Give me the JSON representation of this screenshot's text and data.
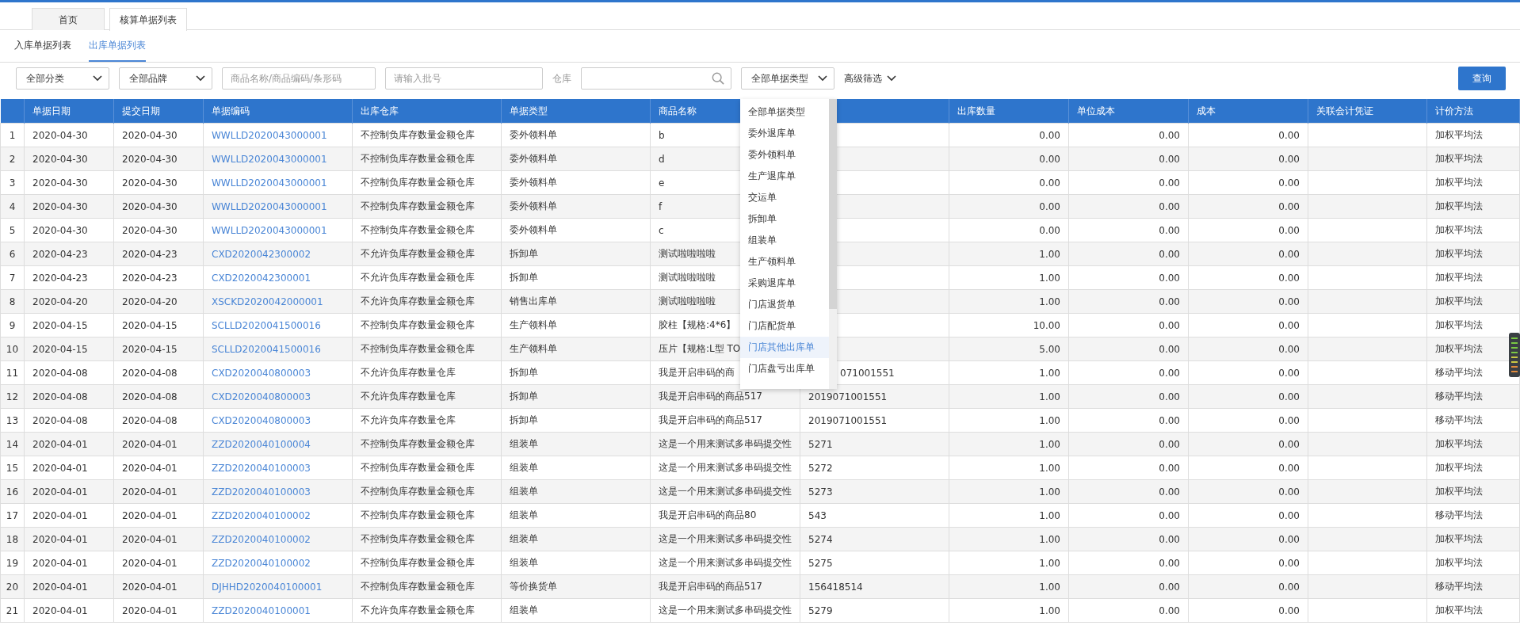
{
  "tabs": [
    {
      "label": "首页",
      "selected": false
    },
    {
      "label": "核算单据列表",
      "selected": true
    }
  ],
  "subtabs": [
    {
      "label": "入库单据列表",
      "selected": false
    },
    {
      "label": "出库单据列表",
      "selected": true
    }
  ],
  "filters": {
    "category": "全部分类",
    "brand": "全部品牌",
    "product_search": {
      "placeholder": "商品名称/商品编码/条形码"
    },
    "batch": {
      "placeholder": "请输入批号"
    },
    "warehouse_label": "仓库",
    "doc_type": "全部单据类型",
    "advanced": "高级筛选",
    "query_button": "查询"
  },
  "doc_type_menu": [
    {
      "label": "全部单据类型",
      "highlighted": false
    },
    {
      "label": "委外退库单",
      "highlighted": false
    },
    {
      "label": "委外领料单",
      "highlighted": false
    },
    {
      "label": "生产退库单",
      "highlighted": false
    },
    {
      "label": "交运单",
      "highlighted": false
    },
    {
      "label": "拆卸单",
      "highlighted": false
    },
    {
      "label": "组装单",
      "highlighted": false
    },
    {
      "label": "生产领料单",
      "highlighted": false
    },
    {
      "label": "采购退库单",
      "highlighted": false
    },
    {
      "label": "门店退货单",
      "highlighted": false
    },
    {
      "label": "门店配货单",
      "highlighted": false
    },
    {
      "label": "门店其他出库单",
      "highlighted": true
    },
    {
      "label": "门店盘亏出库单",
      "highlighted": false
    }
  ],
  "table": {
    "columns": [
      "单据日期",
      "提交日期",
      "单据编码",
      "出库仓库",
      "单据类型",
      "商品名称",
      "出库数量",
      "单位成本",
      "成本",
      "关联会计凭证",
      "计价方法"
    ],
    "rows": [
      {
        "no": "1",
        "date": "2020-04-30",
        "submitted": "2020-04-30",
        "code": "WWLLD2020043000001",
        "warehouse": "不控制负库存数量金额仓库",
        "type": "委外领料单",
        "product": "b",
        "qty": "0.00",
        "unit_cost": "0.00",
        "cost": "0.00",
        "method": "加权平均法"
      },
      {
        "no": "2",
        "date": "2020-04-30",
        "submitted": "2020-04-30",
        "code": "WWLLD2020043000001",
        "warehouse": "不控制负库存数量金额仓库",
        "type": "委外领料单",
        "product": "d",
        "qty": "0.00",
        "unit_cost": "0.00",
        "cost": "0.00",
        "method": "加权平均法"
      },
      {
        "no": "3",
        "date": "2020-04-30",
        "submitted": "2020-04-30",
        "code": "WWLLD2020043000001",
        "warehouse": "不控制负库存数量金额仓库",
        "type": "委外领料单",
        "product": "e",
        "qty": "0.00",
        "unit_cost": "0.00",
        "cost": "0.00",
        "method": "加权平均法"
      },
      {
        "no": "4",
        "date": "2020-04-30",
        "submitted": "2020-04-30",
        "code": "WWLLD2020043000001",
        "warehouse": "不控制负库存数量金额仓库",
        "type": "委外领料单",
        "product": "f",
        "qty": "0.00",
        "unit_cost": "0.00",
        "cost": "0.00",
        "method": "加权平均法"
      },
      {
        "no": "5",
        "date": "2020-04-30",
        "submitted": "2020-04-30",
        "code": "WWLLD2020043000001",
        "warehouse": "不控制负库存数量金额仓库",
        "type": "委外领料单",
        "product": "c",
        "qty": "0.00",
        "unit_cost": "0.00",
        "cost": "0.00",
        "method": "加权平均法"
      },
      {
        "no": "6",
        "date": "2020-04-23",
        "submitted": "2020-04-23",
        "code": "CXD2020042300002",
        "warehouse": "不允许负库存数量金额仓库",
        "type": "拆卸单",
        "product": "测试啦啦啦啦",
        "qty": "1.00",
        "unit_cost": "0.00",
        "cost": "0.00",
        "method": "加权平均法"
      },
      {
        "no": "7",
        "date": "2020-04-23",
        "submitted": "2020-04-23",
        "code": "CXD2020042300001",
        "warehouse": "不允许负库存数量金额仓库",
        "type": "拆卸单",
        "product": "测试啦啦啦啦",
        "qty": "1.00",
        "unit_cost": "0.00",
        "cost": "0.00",
        "method": "加权平均法"
      },
      {
        "no": "8",
        "date": "2020-04-20",
        "submitted": "2020-04-20",
        "code": "XSCKD2020042000001",
        "warehouse": "不允许负库存数量金额仓库",
        "type": "销售出库单",
        "product": "测试啦啦啦啦",
        "qty": "1.00",
        "unit_cost": "0.00",
        "cost": "0.00",
        "method": "加权平均法"
      },
      {
        "no": "9",
        "date": "2020-04-15",
        "submitted": "2020-04-15",
        "code": "SCLLD2020041500016",
        "warehouse": "不控制负库存数量金额仓库",
        "type": "生产领料单",
        "product": "胶柱【规格:4*6】",
        "qty": "10.00",
        "unit_cost": "0.00",
        "cost": "0.00",
        "method": "加权平均法"
      },
      {
        "no": "10",
        "date": "2020-04-15",
        "submitted": "2020-04-15",
        "code": "SCLLD2020041500016",
        "warehouse": "不控制负库存数量金额仓库",
        "type": "生产领料单",
        "product": "压片【规格:L型 TO",
        "qty": "5.00",
        "unit_cost": "0.00",
        "cost": "0.00",
        "method": "加权平均法"
      },
      {
        "no": "11",
        "date": "2020-04-08",
        "submitted": "2020-04-08",
        "code": "CXD2020040800003",
        "warehouse": "不允许负库存数量仓库",
        "type": "拆卸单",
        "product": "我是开启串码的商",
        "column_7": "071001551",
        "qty": "1.00",
        "unit_cost": "0.00",
        "cost": "0.00",
        "method": "移动平均法"
      },
      {
        "no": "12",
        "date": "2020-04-08",
        "submitted": "2020-04-08",
        "code": "CXD2020040800003",
        "warehouse": "不允许负库存数量仓库",
        "type": "拆卸单",
        "product": "我是开启串码的商品517",
        "column_7": "2019071001551",
        "qty": "1.00",
        "unit_cost": "0.00",
        "cost": "0.00",
        "method": "移动平均法"
      },
      {
        "no": "13",
        "date": "2020-04-08",
        "submitted": "2020-04-08",
        "code": "CXD2020040800003",
        "warehouse": "不允许负库存数量仓库",
        "type": "拆卸单",
        "product": "我是开启串码的商品517",
        "column_7": "2019071001551",
        "qty": "1.00",
        "unit_cost": "0.00",
        "cost": "0.00",
        "method": "移动平均法"
      },
      {
        "no": "14",
        "date": "2020-04-01",
        "submitted": "2020-04-01",
        "code": "ZZD2020040100004",
        "warehouse": "不控制负库存数量金额仓库",
        "type": "组装单",
        "product": "这是一个用来测试多串码提交性",
        "column_7": "5271",
        "qty": "1.00",
        "unit_cost": "0.00",
        "cost": "0.00",
        "method": "加权平均法"
      },
      {
        "no": "15",
        "date": "2020-04-01",
        "submitted": "2020-04-01",
        "code": "ZZD2020040100003",
        "warehouse": "不控制负库存数量金额仓库",
        "type": "组装单",
        "product": "这是一个用来测试多串码提交性",
        "column_7": "5272",
        "qty": "1.00",
        "unit_cost": "0.00",
        "cost": "0.00",
        "method": "加权平均法"
      },
      {
        "no": "16",
        "date": "2020-04-01",
        "submitted": "2020-04-01",
        "code": "ZZD2020040100003",
        "warehouse": "不控制负库存数量金额仓库",
        "type": "组装单",
        "product": "这是一个用来测试多串码提交性",
        "column_7": "5273",
        "qty": "1.00",
        "unit_cost": "0.00",
        "cost": "0.00",
        "method": "加权平均法"
      },
      {
        "no": "17",
        "date": "2020-04-01",
        "submitted": "2020-04-01",
        "code": "ZZD2020040100002",
        "warehouse": "不控制负库存数量金额仓库",
        "type": "组装单",
        "product": "我是开启串码的商品80",
        "column_7": "543",
        "qty": "1.00",
        "unit_cost": "0.00",
        "cost": "0.00",
        "method": "移动平均法"
      },
      {
        "no": "18",
        "date": "2020-04-01",
        "submitted": "2020-04-01",
        "code": "ZZD2020040100002",
        "warehouse": "不控制负库存数量金额仓库",
        "type": "组装单",
        "product": "这是一个用来测试多串码提交性",
        "column_7": "5274",
        "qty": "1.00",
        "unit_cost": "0.00",
        "cost": "0.00",
        "method": "加权平均法"
      },
      {
        "no": "19",
        "date": "2020-04-01",
        "submitted": "2020-04-01",
        "code": "ZZD2020040100002",
        "warehouse": "不控制负库存数量金额仓库",
        "type": "组装单",
        "product": "这是一个用来测试多串码提交性",
        "column_7": "5275",
        "qty": "1.00",
        "unit_cost": "0.00",
        "cost": "0.00",
        "method": "加权平均法"
      },
      {
        "no": "20",
        "date": "2020-04-01",
        "submitted": "2020-04-01",
        "code": "DJHHD2020040100001",
        "warehouse": "不控制负库存数量金额仓库",
        "type": "等价换货单",
        "product": "我是开启串码的商品517",
        "column_7": "156418514",
        "qty": "1.00",
        "unit_cost": "0.00",
        "cost": "0.00",
        "method": "移动平均法"
      },
      {
        "no": "21",
        "date": "2020-04-01",
        "submitted": "2020-04-01",
        "code": "ZZD2020040100001",
        "warehouse": "不允许负库存数量金额仓库",
        "type": "组装单",
        "product": "这是一个用来测试多串码提交性",
        "column_7": "5279",
        "qty": "1.00",
        "unit_cost": "0.00",
        "cost": "0.00",
        "method": "加权平均法"
      }
    ]
  }
}
